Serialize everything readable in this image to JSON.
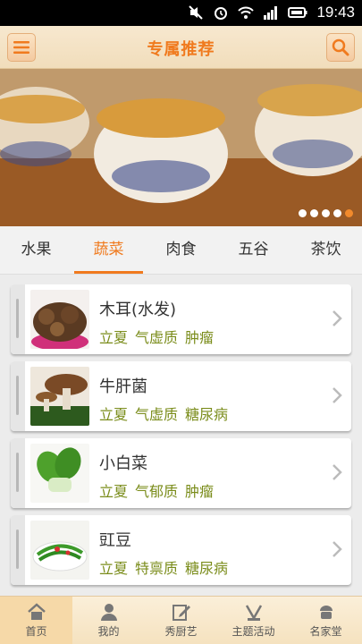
{
  "status_bar": {
    "time": "19:43"
  },
  "header": {
    "title": "专属推荐",
    "menu_icon": "menu-icon",
    "search_icon": "search-icon"
  },
  "banner": {
    "slides": 5,
    "active_slide": 5
  },
  "tabs": [
    {
      "label": "水果",
      "active": false
    },
    {
      "label": "蔬菜",
      "active": true
    },
    {
      "label": "肉食",
      "active": false
    },
    {
      "label": "五谷",
      "active": false
    },
    {
      "label": "茶饮",
      "active": false
    }
  ],
  "items": [
    {
      "title": "木耳(水发)",
      "tags": [
        "立夏",
        "气虚质",
        "肿瘤"
      ]
    },
    {
      "title": "牛肝菌",
      "tags": [
        "立夏",
        "气虚质",
        "糖尿病"
      ]
    },
    {
      "title": "小白菜",
      "tags": [
        "立夏",
        "气郁质",
        "肿瘤"
      ]
    },
    {
      "title": "豇豆",
      "tags": [
        "立夏",
        "特禀质",
        "糖尿病"
      ]
    }
  ],
  "bottom_nav": [
    {
      "label": "首页",
      "icon": "home-icon",
      "active": true
    },
    {
      "label": "我的",
      "icon": "user-icon",
      "active": false
    },
    {
      "label": "秀厨艺",
      "icon": "edit-icon",
      "active": false
    },
    {
      "label": "主题活动",
      "icon": "activity-icon",
      "active": false
    },
    {
      "label": "名家堂",
      "icon": "master-icon",
      "active": false
    }
  ],
  "colors": {
    "accent": "#f07a1e",
    "tag": "#7a8c1a",
    "header_bg": "#f7e8cf"
  }
}
